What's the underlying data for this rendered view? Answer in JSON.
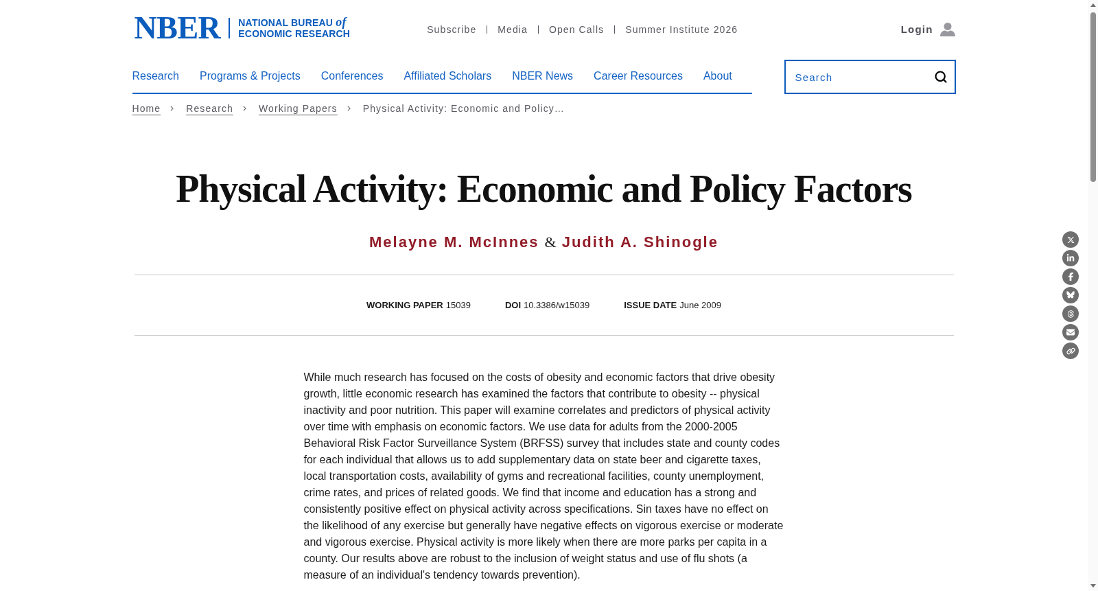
{
  "logo": {
    "wordmark": "NBER",
    "name_lines": [
      "NATIONAL BUREAU *of*",
      "ECONOMIC RESEARCH"
    ]
  },
  "utility_links": [
    "Subscribe",
    "Media",
    "Open Calls",
    "Summer Institute 2026"
  ],
  "login": {
    "label": "Login"
  },
  "nav": [
    "Research",
    "Programs & Projects",
    "Conferences",
    "Affiliated Scholars",
    "NBER News",
    "Career Resources",
    "About"
  ],
  "search": {
    "placeholder": "Search"
  },
  "breadcrumb": [
    {
      "label": "Home",
      "kind": "link"
    },
    {
      "label": "Research",
      "kind": "link"
    },
    {
      "label": "Working Papers",
      "kind": "link"
    },
    {
      "label": "Physical Activity: Economic and Policy…",
      "kind": "current"
    }
  ],
  "title": "Physical Activity: Economic and Policy Factors",
  "authors": [
    "Melayne M. McInnes",
    "Judith A. Shinogle"
  ],
  "author_separator": "&",
  "meta": [
    {
      "label": "WORKING PAPER",
      "value": "15039"
    },
    {
      "label": "DOI",
      "value": "10.3386/w15039"
    },
    {
      "label": "ISSUE DATE",
      "value": "June 2009"
    }
  ],
  "abstract": "While much research has focused on the costs of obesity and economic factors that drive obesity growth, little economic research has examined the factors that contribute to obesity -- physical inactivity and poor nutrition. This paper will examine correlates and predictors of physical activity over time with emphasis on economic factors. We use data for adults from the 2000-2005 Behavioral Risk Factor Surveillance System (BRFSS) survey that includes state and county codes for each individual that allows us to add supplementary data on state beer and cigarette taxes, local transportation costs, availability of gyms and recreational facilities, county unemployment, crime rates, and prices of related goods. We find that income and education has a strong and consistently positive effect on physical activity across specifications. Sin taxes have no effect on the likelihood of any exercise but generally have negative effects on vigorous exercise or moderate and vigorous exercise. Physical activity is more likely when there are more parks per capita in a county. Our results above are robust to the inclusion of weight status and use of flu shots (a measure of an individual's tendency towards prevention)."
}
